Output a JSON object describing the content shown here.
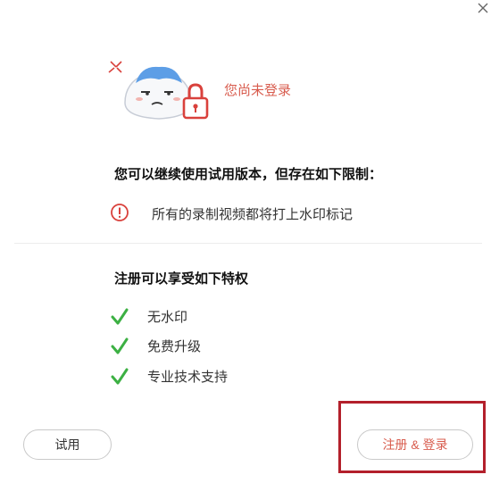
{
  "header": {
    "close_icon": "close-icon",
    "status": "您尚未登录"
  },
  "limitations": {
    "title": "您可以继续使用试用版本，但存在如下限制：",
    "items": [
      {
        "icon": "warning-circle-icon",
        "text": "所有的录制视频都将打上水印标记"
      }
    ]
  },
  "perks": {
    "title": "注册可以享受如下特权",
    "items": [
      {
        "icon": "check-icon",
        "text": "无水印"
      },
      {
        "icon": "check-icon",
        "text": "免费升级"
      },
      {
        "icon": "check-icon",
        "text": "专业技术支持"
      }
    ]
  },
  "buttons": {
    "trial": "试用",
    "register_login": "注册 & 登录"
  },
  "colors": {
    "accent": "#d85c4e",
    "check": "#3cb043",
    "warning": "#d9413c",
    "mascot_hair": "#5d9ee6",
    "highlight_border": "#b3202b"
  }
}
